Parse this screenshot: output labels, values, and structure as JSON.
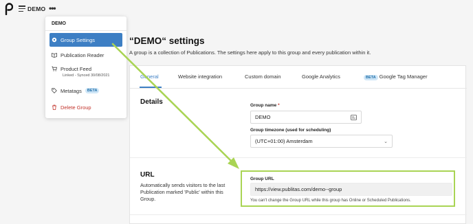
{
  "topbar": {
    "app_title": "DEMO",
    "more_label": "•••"
  },
  "menu": {
    "header": "DEMO",
    "items": [
      {
        "label": "Group Settings",
        "icon": "gear-icon",
        "active": true
      },
      {
        "label": "Publication Reader",
        "icon": "book-open-icon"
      },
      {
        "label": "Product Feed",
        "icon": "cart-icon",
        "sub": "Linked - Synced 30/08/2021"
      },
      {
        "label": "Metatags",
        "icon": "tag-icon",
        "badge": "BETA"
      },
      {
        "label": "Delete Group",
        "icon": "trash-icon",
        "danger": true
      }
    ]
  },
  "main": {
    "title": "“DEMO“ settings",
    "description": "A group is a collection of Publications. The settings here apply to this group and every publication within it.",
    "tabs": [
      {
        "label": "General",
        "active": true
      },
      {
        "label": "Website integration"
      },
      {
        "label": "Custom domain"
      },
      {
        "label": "Google Analytics"
      },
      {
        "label": "Google Tag Manager",
        "badge": "BETA"
      }
    ],
    "details": {
      "title": "Details",
      "group_name_label": "Group name",
      "required_mark": "*",
      "group_name_value": "DEMO",
      "timezone_label": "Group timezone (used for scheduling)",
      "timezone_value": "(UTC+01:00) Amsterdam"
    },
    "url": {
      "title": "URL",
      "description": "Automatically sends visitors to the last Publication marked 'Public' within this Group.",
      "field_label": "Group URL",
      "field_value": "https://view.publitas.com/demo--group",
      "hint": "You can't change the Group URL while this group has Online or Scheduled Publications."
    }
  },
  "colors": {
    "accent": "#3d7fc4",
    "danger": "#c2332b",
    "highlight": "#a9d454"
  }
}
